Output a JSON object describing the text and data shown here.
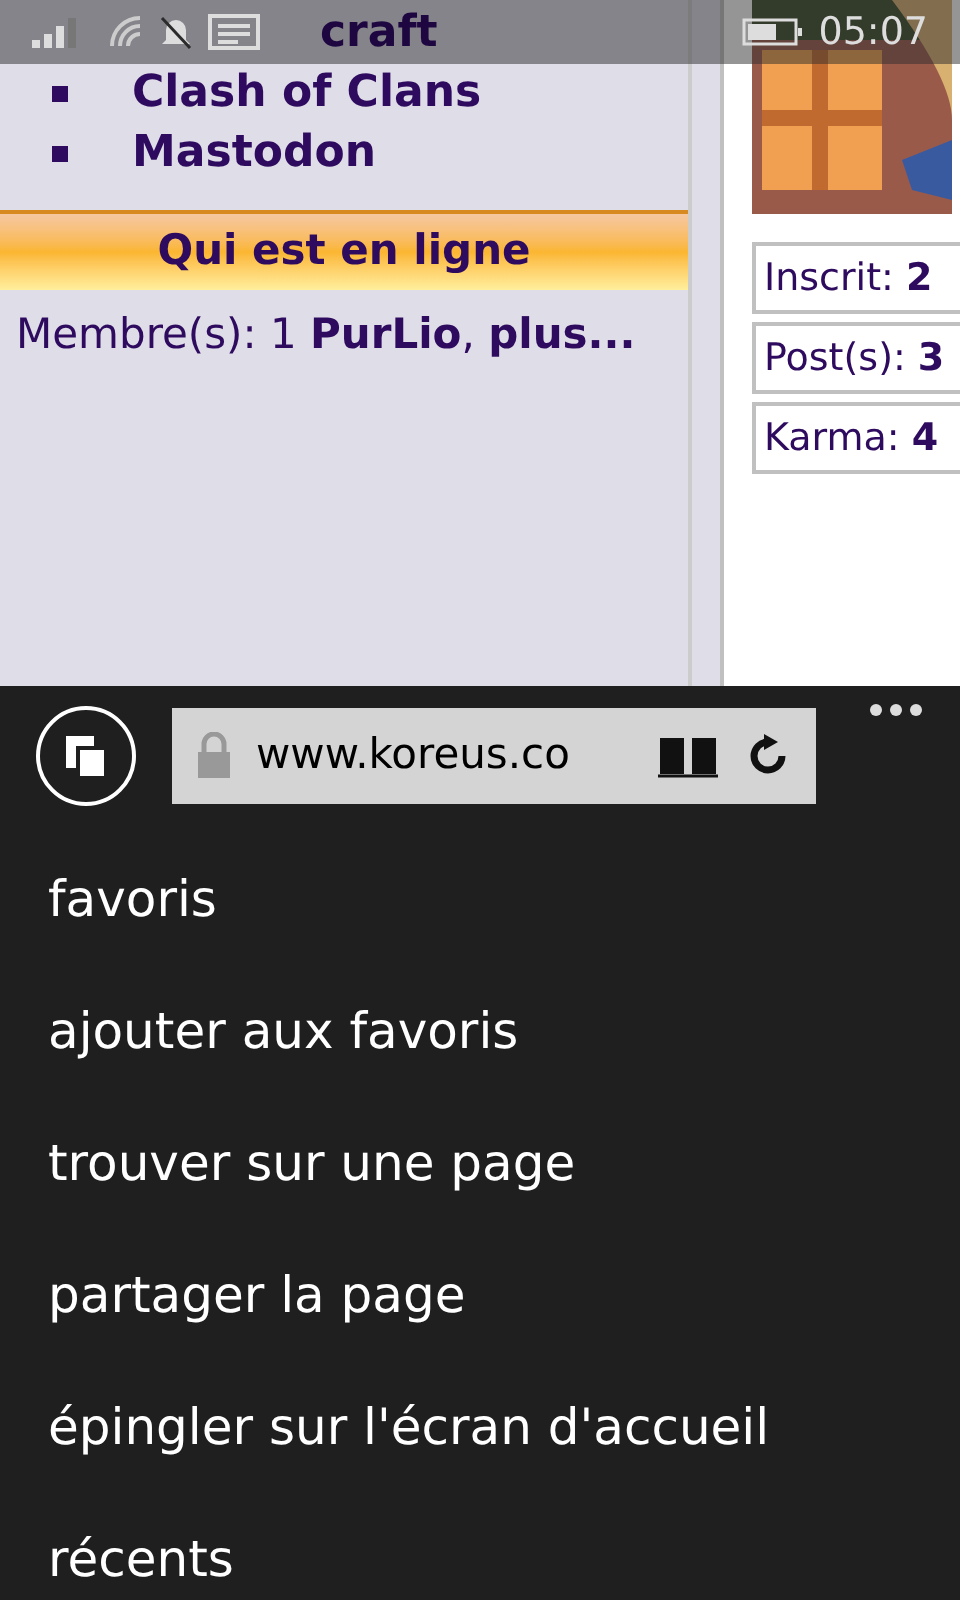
{
  "status_bar": {
    "time": "05:07"
  },
  "sidebar": {
    "list": [
      {
        "text": "craft",
        "kind": "cut"
      },
      {
        "text": "Clash of Clans",
        "kind": "item"
      },
      {
        "text": "Mastodon",
        "kind": "item"
      }
    ],
    "online": {
      "title": "Qui est en ligne",
      "members": "Membre(s): 1 **PurLio**, **plus...**"
    }
  },
  "profile": {
    "stats": [
      "Inscrit: **2**",
      "Post(s): **3**",
      "Karma: **4**"
    ]
  },
  "address_bar": {
    "url": "www.koreus.co"
  },
  "menu": [
    "favoris",
    "ajouter aux favoris",
    "trouver sur une page",
    "partager la page",
    "épingler sur l'écran d'accueil",
    "récents"
  ]
}
